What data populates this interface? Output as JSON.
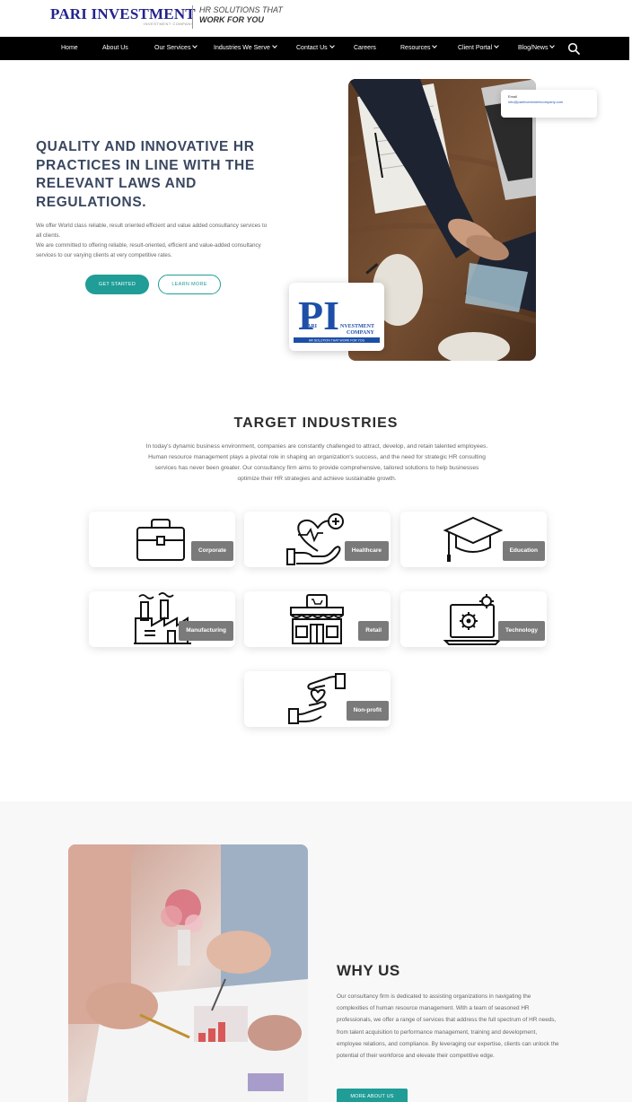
{
  "header": {
    "logo_name": "PARI INVESTMENT",
    "logo_sub": "INVESTMENT COMPANY",
    "tagline_line1": "HR SOLUTIONS THAT",
    "tagline_line2": "WORK FOR YOU"
  },
  "nav": {
    "items": [
      {
        "label": "Home",
        "dropdown": false
      },
      {
        "label": "About Us",
        "dropdown": false
      },
      {
        "label": "Our Services",
        "dropdown": true
      },
      {
        "label": "Industries We Serve",
        "dropdown": true
      },
      {
        "label": "Contact Us",
        "dropdown": true
      },
      {
        "label": "Careers",
        "dropdown": false
      },
      {
        "label": "Resources",
        "dropdown": true
      },
      {
        "label": "Client Portal",
        "dropdown": true
      },
      {
        "label": "Blog/News",
        "dropdown": true
      }
    ],
    "search_icon": "search-icon"
  },
  "hero": {
    "title": "QUALITY AND INNOVATIVE HR PRACTICES IN LINE WITH THE RELEVANT LAWS AND REGULATIONS.",
    "paragraph1": "We offer World class reliable, result oriented efficient and value added consultancy services to all clients.",
    "paragraph2": "We are committed to offering reliable, result-oriented, efficient and value-added consultancy services to our varying clients at very competitive rates.",
    "cta_primary": "GET STARTED",
    "cta_secondary": "LEARN MORE",
    "float_card_label": "Email",
    "float_card_link": "info@pariinvestmentcompany.com",
    "logo_card": {
      "mark": "PI",
      "line1": "ARI",
      "line2": "NVESTMENT",
      "line3": "COMPANY",
      "slogan": "HR SOLUTION THAT WORK FOR YOU"
    }
  },
  "industries": {
    "title": "TARGET INDUSTRIES",
    "description": "In today's dynamic business environment, companies are constantly challenged to attract, develop, and retain talented employees. Human resource management plays a pivotal role in shaping an organization's success, and the need for strategic HR consulting services has never been greater. Our consultancy firm aims to provide comprehensive, tailored solutions to help businesses optimize their HR strategies and achieve sustainable growth.",
    "cards": [
      {
        "label": "Corporate",
        "icon": "briefcase-icon"
      },
      {
        "label": "Healthcare",
        "icon": "heart-hand-icon"
      },
      {
        "label": "Education",
        "icon": "graduation-cap-icon"
      },
      {
        "label": "Manufacturing",
        "icon": "factory-icon"
      },
      {
        "label": "Retail",
        "icon": "store-icon"
      },
      {
        "label": "Technology",
        "icon": "laptop-gear-icon"
      },
      {
        "label": "Non-profit",
        "icon": "giving-hands-icon"
      }
    ]
  },
  "why_us": {
    "title": "WHY US",
    "paragraph": "Our consultancy firm is dedicated to assisting organizations in navigating the complexities of human resource management. With a team of seasoned HR professionals, we offer a range of services that address the full spectrum of HR needs, from talent acquisition to performance management, training and development, employee relations, and compliance. By leveraging our expertise, clients can unlock the potential of their workforce and elevate their competitive edge.",
    "button": "MORE ABOUT US"
  },
  "colors": {
    "brand_blue": "#23238e",
    "teal_accent": "#1f9d96",
    "nav_bg": "#000000",
    "label_gray": "#7a7a7a"
  }
}
